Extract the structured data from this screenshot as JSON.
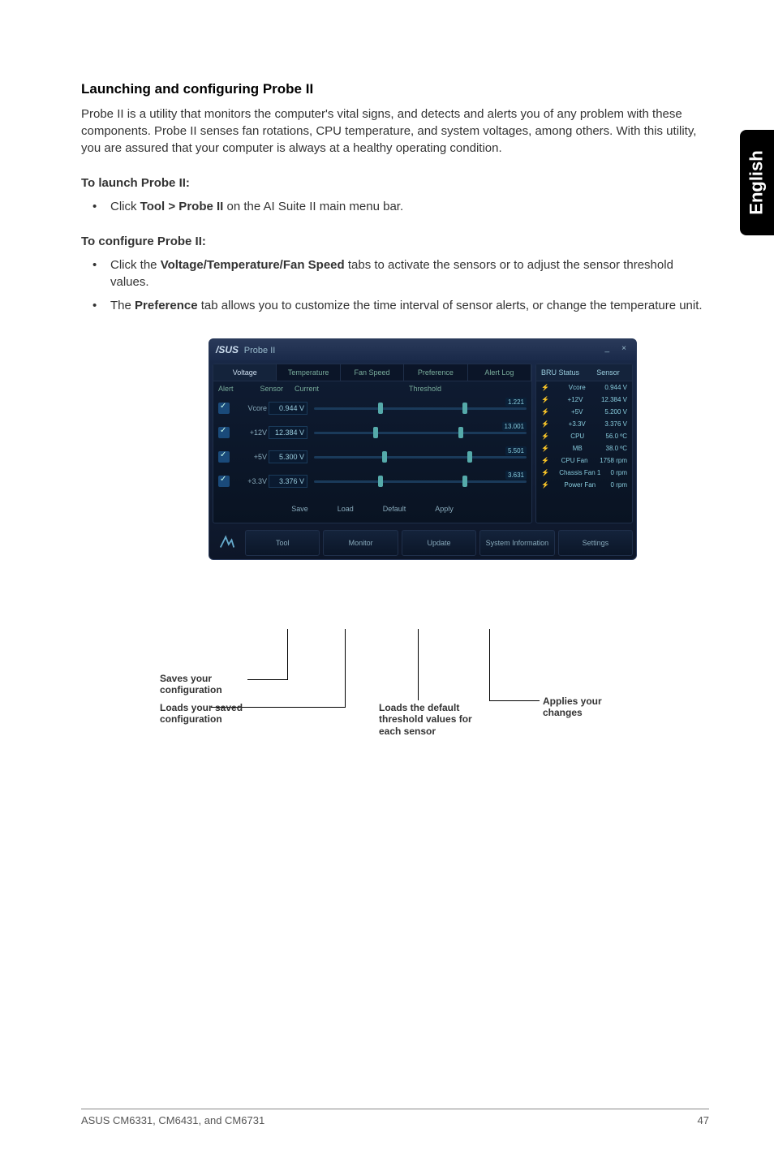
{
  "sidebar_language": "English",
  "section_title": "Launching and configuring Probe II",
  "intro": "Probe II is a utility that monitors the computer's vital signs, and detects and alerts you of any problem with these components. Probe II senses fan rotations, CPU temperature, and system voltages, among others. With this utility, you are assured that your computer is always at a healthy operating condition.",
  "launch_head": "To launch Probe II:",
  "launch_item_pre": "Click ",
  "launch_item_bold": "Tool > Probe II",
  "launch_item_post": " on the AI Suite II main menu bar.",
  "configure_head": "To configure Probe II:",
  "conf_item1_pre": "Click the ",
  "conf_item1_bold": "Voltage/Temperature/Fan Speed",
  "conf_item1_post": " tabs to activate the sensors or to adjust the sensor threshold values.",
  "conf_item2_pre": "The ",
  "conf_item2_bold": "Preference",
  "conf_item2_post": " tab allows you to customize the time interval of sensor alerts, or change the temperature unit.",
  "app": {
    "logo": "/SUS",
    "title": "Probe II",
    "min": "_",
    "close": "×",
    "tabs": [
      "Voltage",
      "Temperature",
      "Fan Speed",
      "Preference",
      "Alert Log"
    ],
    "hdr": {
      "alert": "Alert",
      "sensor": "Sensor",
      "current": "Current",
      "threshold": "Threshold"
    },
    "rows": [
      {
        "name": "Vcore",
        "val": "0.944 V",
        "badge": "1.221"
      },
      {
        "name": "+12V",
        "val": "12.384 V",
        "badge": "13.001"
      },
      {
        "name": "+5V",
        "val": "5.300 V",
        "badge": "5.501"
      },
      {
        "name": "+3.3V",
        "val": "3.376 V",
        "badge": "3.631"
      }
    ],
    "btns": {
      "save": "Save",
      "load": "Load",
      "def": "Default",
      "apply": "Apply"
    },
    "right": {
      "hdr1": "BRU Status",
      "hdr2": "Sensor",
      "rows": [
        {
          "n": "Vcore",
          "v": "0.944 V"
        },
        {
          "n": "+12V",
          "v": "12.384 V"
        },
        {
          "n": "+5V",
          "v": "5.200 V"
        },
        {
          "n": "+3.3V",
          "v": "3.376 V"
        },
        {
          "n": "CPU",
          "v": "56.0 ºC"
        },
        {
          "n": "MB",
          "v": "38.0 ºC"
        },
        {
          "n": "CPU Fan",
          "v": "1758 rpm"
        },
        {
          "n": "Chassis Fan 1",
          "v": "0 rpm"
        },
        {
          "n": "Power Fan",
          "v": "0 rpm"
        }
      ]
    },
    "bottom": [
      "Tool",
      "Monitor",
      "Update",
      "System Information",
      "Settings"
    ]
  },
  "callouts": {
    "saves": "Saves your configuration",
    "loads": "Loads your saved configuration",
    "def": "Loads the default threshold values for each sensor",
    "apply": "Applies your changes"
  },
  "footer_left": "ASUS CM6331, CM6431, and CM6731",
  "footer_right": "47"
}
